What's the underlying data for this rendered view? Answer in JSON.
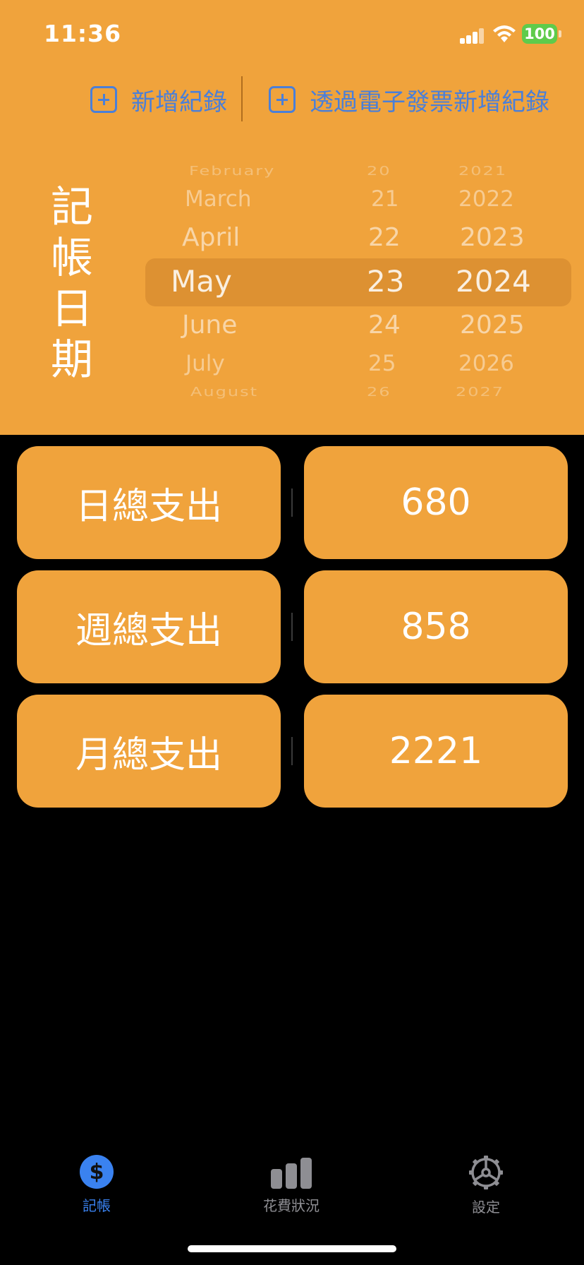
{
  "status_bar": {
    "time": "11:36",
    "battery": "100"
  },
  "actions": {
    "add_record": "新增紀錄",
    "add_via_einvoice": "透過電子發票新增紀錄"
  },
  "date_label": [
    "記",
    "帳",
    "日",
    "期"
  ],
  "picker": {
    "months": [
      "February",
      "March",
      "April",
      "May",
      "June",
      "July",
      "August"
    ],
    "days": [
      "20",
      "21",
      "22",
      "23",
      "24",
      "25",
      "26"
    ],
    "years": [
      "2021",
      "2022",
      "2023",
      "2024",
      "2025",
      "2026",
      "2027"
    ],
    "selected": {
      "month": "May",
      "day": "23",
      "year": "2024"
    }
  },
  "summary": [
    {
      "label": "日總支出",
      "value": "680"
    },
    {
      "label": "週總支出",
      "value": "858"
    },
    {
      "label": "月總支出",
      "value": "2221"
    }
  ],
  "tabs": [
    {
      "label": "記帳",
      "icon": "dollar-circle-icon",
      "active": true
    },
    {
      "label": "花費狀況",
      "icon": "bar-chart-icon",
      "active": false
    },
    {
      "label": "設定",
      "icon": "gear-icon",
      "active": false
    }
  ],
  "colors": {
    "accent": "#F0A33C",
    "link": "#4A7FD9",
    "tab_active": "#3A82F0",
    "background": "#000000"
  }
}
